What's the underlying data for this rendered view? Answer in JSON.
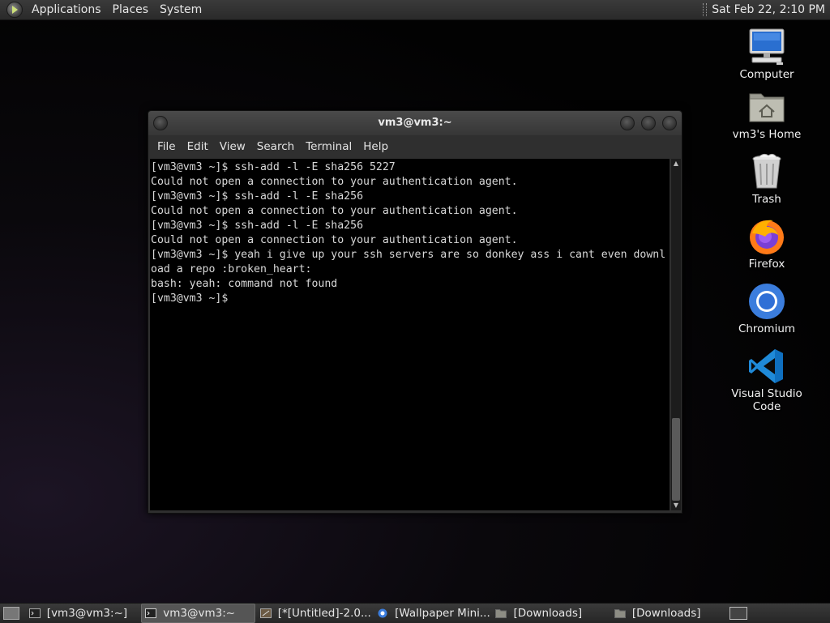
{
  "top_panel": {
    "menus": [
      "Applications",
      "Places",
      "System"
    ],
    "clock": "Sat Feb 22,  2:10 PM"
  },
  "desktop_icons": [
    {
      "label": "Computer",
      "icon": "computer-icon"
    },
    {
      "label": "vm3's Home",
      "icon": "home-folder-icon"
    },
    {
      "label": "Trash",
      "icon": "trash-icon"
    },
    {
      "label": "Firefox",
      "icon": "firefox-icon"
    },
    {
      "label": "Chromium",
      "icon": "chromium-icon"
    },
    {
      "label": "Visual Studio Code",
      "icon": "vscode-icon"
    }
  ],
  "terminal": {
    "title": "vm3@vm3:~",
    "menu": [
      "File",
      "Edit",
      "View",
      "Search",
      "Terminal",
      "Help"
    ],
    "lines": [
      "[vm3@vm3 ~]$ ssh-add -l -E sha256 5227",
      "Could not open a connection to your authentication agent.",
      "[vm3@vm3 ~]$ ssh-add -l -E sha256",
      "Could not open a connection to your authentication agent.",
      "[vm3@vm3 ~]$ ssh-add -l -E sha256",
      "Could not open a connection to your authentication agent.",
      "[vm3@vm3 ~]$ yeah i give up your ssh servers are so donkey ass i cant even downl",
      "oad a repo :broken_heart:",
      "bash: yeah: command not found",
      "[vm3@vm3 ~]$ "
    ]
  },
  "taskbar": {
    "tasks": [
      {
        "label": "[vm3@vm3:~]",
        "icon": "terminal-icon",
        "active": false
      },
      {
        "label": "vm3@vm3:~",
        "icon": "terminal-icon",
        "active": true
      },
      {
        "label": "[*[Untitled]-2.0...",
        "icon": "gimp-icon",
        "active": false
      },
      {
        "label": "[Wallpaper Mini...",
        "icon": "chromium-icon",
        "active": false
      },
      {
        "label": "[Downloads]",
        "icon": "folder-icon",
        "active": false
      },
      {
        "label": "[Downloads]",
        "icon": "folder-icon",
        "active": false
      }
    ]
  }
}
